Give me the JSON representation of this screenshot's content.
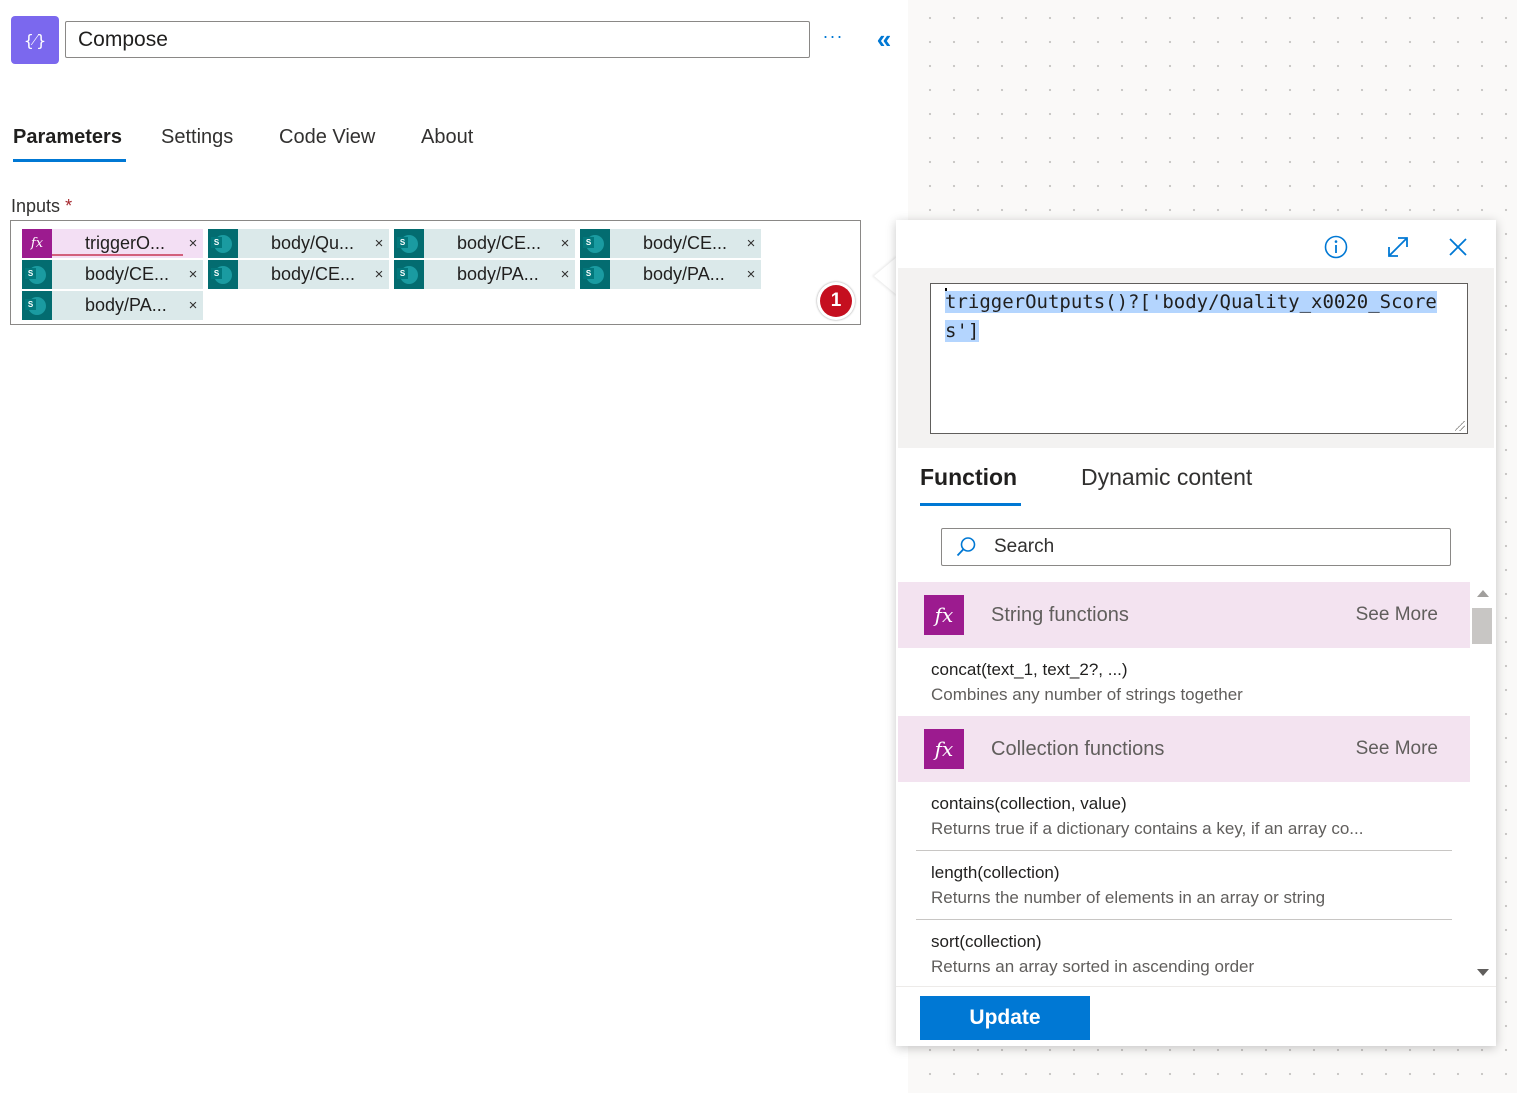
{
  "header": {
    "title_value": "Compose",
    "more_label": "···",
    "collapse_label": "«"
  },
  "tabs": [
    {
      "label": "Parameters",
      "active": true
    },
    {
      "label": "Settings",
      "active": false
    },
    {
      "label": "Code View",
      "active": false
    },
    {
      "label": "About",
      "active": false
    }
  ],
  "inputs": {
    "label": "Inputs",
    "required_mark": "*",
    "tokens": [
      {
        "kind": "expression",
        "icon": "fx-icon",
        "label": "triggerO..."
      },
      {
        "kind": "sharepoint",
        "icon": "sharepoint-icon",
        "label": "body/Qu..."
      },
      {
        "kind": "sharepoint",
        "icon": "sharepoint-icon",
        "label": "body/CE..."
      },
      {
        "kind": "sharepoint",
        "icon": "sharepoint-icon",
        "label": "body/CE..."
      },
      {
        "kind": "sharepoint",
        "icon": "sharepoint-icon",
        "label": "body/CE..."
      },
      {
        "kind": "sharepoint",
        "icon": "sharepoint-icon",
        "label": "body/CE..."
      },
      {
        "kind": "sharepoint",
        "icon": "sharepoint-icon",
        "label": "body/PA..."
      },
      {
        "kind": "sharepoint",
        "icon": "sharepoint-icon",
        "label": "body/PA..."
      },
      {
        "kind": "sharepoint",
        "icon": "sharepoint-icon",
        "label": "body/PA..."
      }
    ],
    "token_close": "×",
    "badge_count": "1"
  },
  "popup": {
    "expression": "triggerOutputs()?['body/Quality_x0020_Scores']",
    "tabs": [
      {
        "label": "Function",
        "active": true
      },
      {
        "label": "Dynamic content",
        "active": false
      }
    ],
    "search_placeholder": "Search",
    "categories": [
      {
        "name": "String functions",
        "see_more": "See More",
        "items": [
          {
            "signature": "concat(text_1, text_2?, ...)",
            "description": "Combines any number of strings together"
          }
        ]
      },
      {
        "name": "Collection functions",
        "see_more": "See More",
        "items": [
          {
            "signature": "contains(collection, value)",
            "description": "Returns true if a dictionary contains a key, if an array co..."
          },
          {
            "signature": "length(collection)",
            "description": "Returns the number of elements in an array or string"
          },
          {
            "signature": "sort(collection)",
            "description": "Returns an array sorted in ascending order"
          }
        ]
      }
    ],
    "update_label": "Update"
  },
  "colors": {
    "accent": "#0078d4",
    "action_icon": "#7b68ee",
    "expression_token": "#9c1b8f",
    "sharepoint_token": "#036c70",
    "badge": "#c50f1f"
  }
}
